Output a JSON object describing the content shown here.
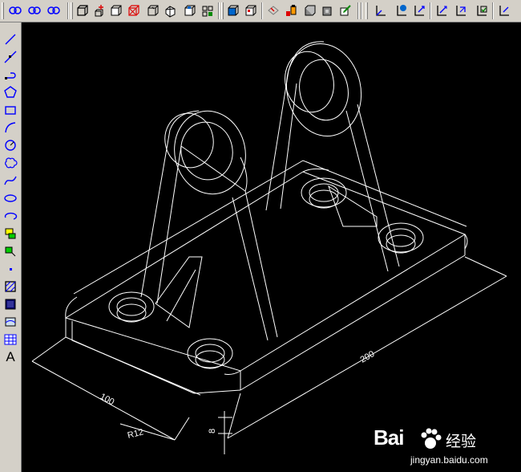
{
  "toolbar": {
    "icons": [
      "view-orbit-icon",
      "view-orbit-constrained-icon",
      "view-orbit-continuous-icon",
      "box-icon",
      "add-solid-icon",
      "cube-icon",
      "cube-wire-icon",
      "cube-hidden-icon",
      "cube-flat-icon",
      "cube-gouraud-icon",
      "cube-gouraud-edges-icon",
      "shade-edges-icon",
      "shade-cube-icon",
      "extract-solid-icon",
      "color-bucket-icon",
      "render-icon",
      "material-icon",
      "scene-icon",
      "ucs-icon",
      "ucs-world-icon",
      "ucs-origin-icon",
      "ucs-3point-icon",
      "ucs-face-icon",
      "ucs-named-icon",
      "ucs-view-icon"
    ]
  },
  "draw_toolbar": {
    "icons": [
      "line-icon",
      "construction-line-icon",
      "polyline-icon",
      "polygon-icon",
      "rectangle-icon",
      "arc-icon",
      "circle-icon",
      "revision-cloud-icon",
      "spline-icon",
      "ellipse-icon",
      "ellipse-arc-icon",
      "insert-block-icon",
      "make-block-icon",
      "point-icon",
      "hatch-icon",
      "gradient-icon",
      "region-icon",
      "table-icon",
      "multiline-text-icon"
    ],
    "text_tool_label": "A"
  },
  "drawing": {
    "dimensions": {
      "length": "200",
      "width": "100",
      "radius": "R12",
      "height": "8"
    },
    "colors": {
      "background": "#000000",
      "lines": "#ffffff"
    }
  },
  "watermark": {
    "logo": "Bai",
    "logo_suffix": "经验",
    "url": "jingyan.baidu.com"
  }
}
